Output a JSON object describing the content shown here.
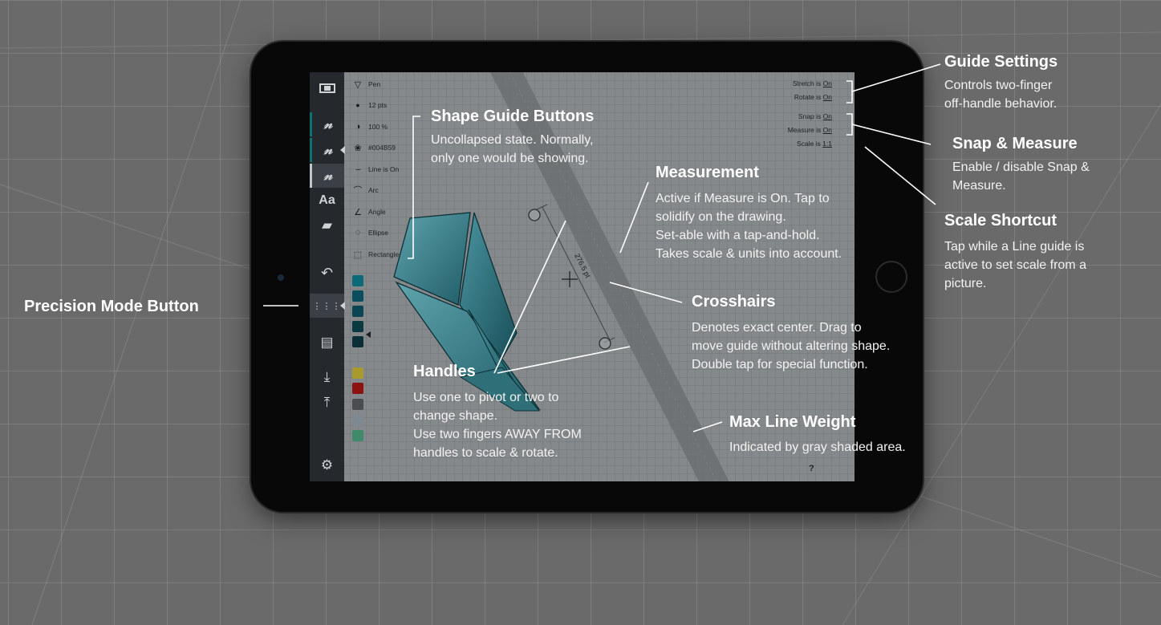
{
  "tool_panel": {
    "items": [
      {
        "icon": "pen-icon",
        "label": "Pen"
      },
      {
        "icon": "dot-icon",
        "label": "12 pts"
      },
      {
        "icon": "opacity-icon",
        "label": "100 %"
      },
      {
        "icon": "palette-icon",
        "label": "#004B59"
      },
      {
        "icon": "dashed-line-icon",
        "label": "Line is On"
      },
      {
        "icon": "arc-icon",
        "label": "Arc"
      },
      {
        "icon": "angle-icon",
        "label": "Angle"
      },
      {
        "icon": "ellipse-icon",
        "label": "Ellipse"
      },
      {
        "icon": "rectangle-icon",
        "label": "Rectangle"
      }
    ]
  },
  "sidebar": {
    "text_tool_label": "Aa"
  },
  "swatches": [
    "#0c6a78",
    "#0a4d5c",
    "#0b4553",
    "#0a3942",
    "#0a2f37",
    "#a89a2c",
    "#8c1212",
    "#4a4c50",
    "#7e8890",
    "#3e8a6a"
  ],
  "settings": {
    "stretch": {
      "label": "Stretch is",
      "value": "On"
    },
    "rotate": {
      "label": "Rotate is",
      "value": "On"
    },
    "snap": {
      "label": "Snap is",
      "value": "On"
    },
    "measure": {
      "label": "Measure is",
      "value": "On"
    },
    "scale": {
      "label": "Scale is",
      "value": "1:1"
    }
  },
  "measurement_label": "276.5 pt",
  "help_label": "?",
  "annotations": {
    "guide_settings": {
      "title": "Guide Settings",
      "lines": [
        "Controls two-finger",
        "off-handle behavior."
      ]
    },
    "shape_guide_buttons": {
      "title": "Shape Guide Buttons",
      "lines": [
        "Uncollapsed state. Normally,",
        "only one would be showing."
      ]
    },
    "snap_measure": {
      "title": "Snap & Measure",
      "lines": [
        "Enable / disable Snap &",
        "Measure."
      ]
    },
    "measurement": {
      "title": "Measurement",
      "lines": [
        "Active if Measure is On. Tap to",
        "solidify on the drawing.",
        "Set-able with a tap-and-hold.",
        "Takes scale & units into account."
      ]
    },
    "scale_shortcut": {
      "title": "Scale Shortcut",
      "lines": [
        "Tap while a Line guide is",
        "active to set scale from a",
        "picture."
      ]
    },
    "precision_mode": {
      "title": "Precision Mode Button"
    },
    "crosshairs": {
      "title": "Crosshairs",
      "lines": [
        "Denotes exact center. Drag to",
        "move guide without altering shape.",
        "Double tap for special function."
      ]
    },
    "handles": {
      "title": "Handles",
      "lines": [
        "Use one to pivot or two to",
        "change shape.",
        "Use two fingers AWAY FROM",
        "handles to scale & rotate."
      ]
    },
    "max_line_weight": {
      "title": "Max Line Weight",
      "lines": [
        "Indicated by gray shaded area."
      ]
    }
  }
}
